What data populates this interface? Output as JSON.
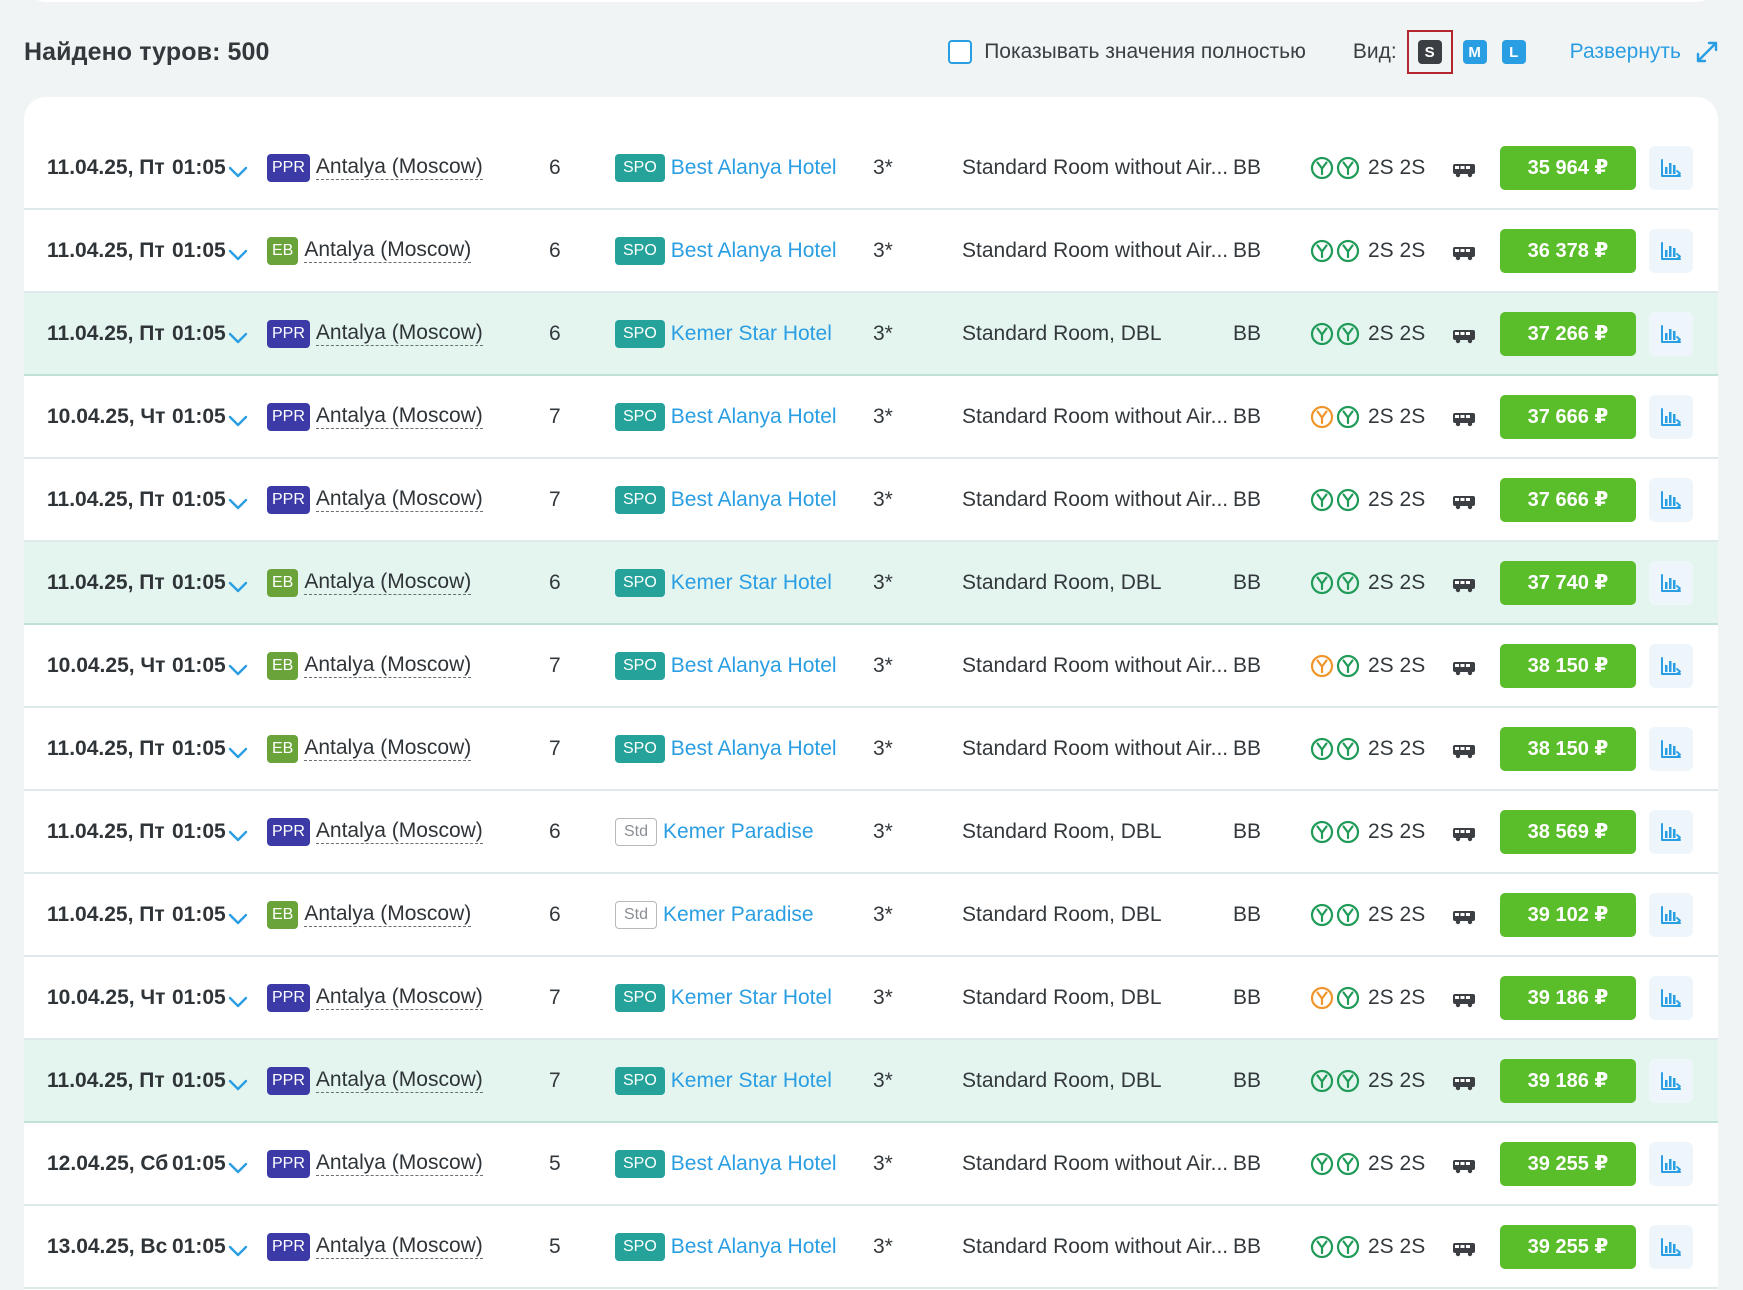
{
  "toolbar": {
    "found_label": "Найдено туров: 500",
    "show_full_label": "Показывать значения полностью",
    "view_label": "Вид:",
    "sizes": [
      "S",
      "M",
      "L"
    ],
    "expand_label": "Развернуть"
  },
  "colors": {
    "accent": "#2a9ee3",
    "price": "#5abd2a",
    "highlight_row": "#e4f5ef",
    "ppr_badge": "#3b3aa6",
    "eb_badge": "#6aa33a",
    "spo_badge": "#25a29a",
    "flight_green": "#1f9a57",
    "flight_orange": "#f0952b"
  },
  "tours": [
    {
      "date": "11.04.25, Пт",
      "time": "01:05",
      "op": "PPR",
      "city": "Antalya (Moscow)",
      "nights": "6",
      "type": "SPO",
      "hotel": "Best Alanya Hotel",
      "stars": "3*",
      "room": "Standard Room without Air...",
      "meal": "BB",
      "flight1": "green",
      "flight2": "green",
      "seats": "2S 2S",
      "price": "35 964 ₽",
      "hl": false
    },
    {
      "date": "11.04.25, Пт",
      "time": "01:05",
      "op": "EB",
      "city": "Antalya (Moscow)",
      "nights": "6",
      "type": "SPO",
      "hotel": "Best Alanya Hotel",
      "stars": "3*",
      "room": "Standard Room without Air...",
      "meal": "BB",
      "flight1": "green",
      "flight2": "green",
      "seats": "2S 2S",
      "price": "36 378 ₽",
      "hl": false
    },
    {
      "date": "11.04.25, Пт",
      "time": "01:05",
      "op": "PPR",
      "city": "Antalya (Moscow)",
      "nights": "6",
      "type": "SPO",
      "hotel": "Kemer Star Hotel",
      "stars": "3*",
      "room": "Standard Room, DBL",
      "meal": "BB",
      "flight1": "green",
      "flight2": "green",
      "seats": "2S 2S",
      "price": "37 266 ₽",
      "hl": true
    },
    {
      "date": "10.04.25, Чт",
      "time": "01:05",
      "op": "PPR",
      "city": "Antalya (Moscow)",
      "nights": "7",
      "type": "SPO",
      "hotel": "Best Alanya Hotel",
      "stars": "3*",
      "room": "Standard Room without Air...",
      "meal": "BB",
      "flight1": "orange",
      "flight2": "green",
      "seats": "2S 2S",
      "price": "37 666 ₽",
      "hl": false
    },
    {
      "date": "11.04.25, Пт",
      "time": "01:05",
      "op": "PPR",
      "city": "Antalya (Moscow)",
      "nights": "7",
      "type": "SPO",
      "hotel": "Best Alanya Hotel",
      "stars": "3*",
      "room": "Standard Room without Air...",
      "meal": "BB",
      "flight1": "green",
      "flight2": "green",
      "seats": "2S 2S",
      "price": "37 666 ₽",
      "hl": false
    },
    {
      "date": "11.04.25, Пт",
      "time": "01:05",
      "op": "EB",
      "city": "Antalya (Moscow)",
      "nights": "6",
      "type": "SPO",
      "hotel": "Kemer Star Hotel",
      "stars": "3*",
      "room": "Standard Room, DBL",
      "meal": "BB",
      "flight1": "green",
      "flight2": "green",
      "seats": "2S 2S",
      "price": "37 740 ₽",
      "hl": true
    },
    {
      "date": "10.04.25, Чт",
      "time": "01:05",
      "op": "EB",
      "city": "Antalya (Moscow)",
      "nights": "7",
      "type": "SPO",
      "hotel": "Best Alanya Hotel",
      "stars": "3*",
      "room": "Standard Room without Air...",
      "meal": "BB",
      "flight1": "orange",
      "flight2": "green",
      "seats": "2S 2S",
      "price": "38 150 ₽",
      "hl": false
    },
    {
      "date": "11.04.25, Пт",
      "time": "01:05",
      "op": "EB",
      "city": "Antalya (Moscow)",
      "nights": "7",
      "type": "SPO",
      "hotel": "Best Alanya Hotel",
      "stars": "3*",
      "room": "Standard Room without Air...",
      "meal": "BB",
      "flight1": "green",
      "flight2": "green",
      "seats": "2S 2S",
      "price": "38 150 ₽",
      "hl": false
    },
    {
      "date": "11.04.25, Пт",
      "time": "01:05",
      "op": "PPR",
      "city": "Antalya (Moscow)",
      "nights": "6",
      "type": "Std",
      "hotel": "Kemer Paradise",
      "stars": "3*",
      "room": "Standard Room, DBL",
      "meal": "BB",
      "flight1": "green",
      "flight2": "green",
      "seats": "2S 2S",
      "price": "38 569 ₽",
      "hl": false
    },
    {
      "date": "11.04.25, Пт",
      "time": "01:05",
      "op": "EB",
      "city": "Antalya (Moscow)",
      "nights": "6",
      "type": "Std",
      "hotel": "Kemer Paradise",
      "stars": "3*",
      "room": "Standard Room, DBL",
      "meal": "BB",
      "flight1": "green",
      "flight2": "green",
      "seats": "2S 2S",
      "price": "39 102 ₽",
      "hl": false
    },
    {
      "date": "10.04.25, Чт",
      "time": "01:05",
      "op": "PPR",
      "city": "Antalya (Moscow)",
      "nights": "7",
      "type": "SPO",
      "hotel": "Kemer Star Hotel",
      "stars": "3*",
      "room": "Standard Room, DBL",
      "meal": "BB",
      "flight1": "orange",
      "flight2": "green",
      "seats": "2S 2S",
      "price": "39 186 ₽",
      "hl": false
    },
    {
      "date": "11.04.25, Пт",
      "time": "01:05",
      "op": "PPR",
      "city": "Antalya (Moscow)",
      "nights": "7",
      "type": "SPO",
      "hotel": "Kemer Star Hotel",
      "stars": "3*",
      "room": "Standard Room, DBL",
      "meal": "BB",
      "flight1": "green",
      "flight2": "green",
      "seats": "2S 2S",
      "price": "39 186 ₽",
      "hl": true
    },
    {
      "date": "12.04.25, Сб",
      "time": "01:05",
      "op": "PPR",
      "city": "Antalya (Moscow)",
      "nights": "5",
      "type": "SPO",
      "hotel": "Best Alanya Hotel",
      "stars": "3*",
      "room": "Standard Room without Air...",
      "meal": "BB",
      "flight1": "green",
      "flight2": "green",
      "seats": "2S 2S",
      "price": "39 255 ₽",
      "hl": false
    },
    {
      "date": "13.04.25, Вс",
      "time": "01:05",
      "op": "PPR",
      "city": "Antalya (Moscow)",
      "nights": "5",
      "type": "SPO",
      "hotel": "Best Alanya Hotel",
      "stars": "3*",
      "room": "Standard Room without Air...",
      "meal": "BB",
      "flight1": "green",
      "flight2": "green",
      "seats": "2S 2S",
      "price": "39 255 ₽",
      "hl": false
    }
  ]
}
